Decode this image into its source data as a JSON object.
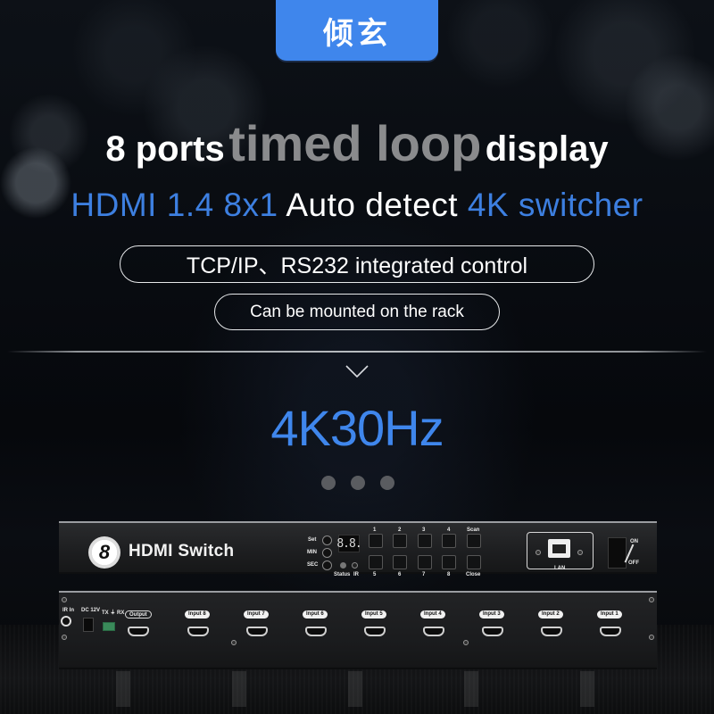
{
  "brand": {
    "name": "倾玄",
    "color": "#3f86ec"
  },
  "headline": {
    "part1": "8 ports",
    "part2": "timed loop",
    "part3": "display"
  },
  "subline": {
    "part1": "HDMI 1.4 8x1",
    "part2": "Auto detect",
    "part3": "4K switcher",
    "accent_color": "#3d7fe0"
  },
  "features": [
    "TCP/IP、RS232 integrated control",
    "Can be mounted on the rack"
  ],
  "resolution": "4K30Hz",
  "carousel": {
    "dots": 3
  },
  "device_front": {
    "logo_glyph": "8",
    "logo_text": "HDMI Switch",
    "knob_labels": [
      "Set",
      "MIN",
      "SEC"
    ],
    "display_value": "8.8.",
    "indicator_labels": [
      "Status",
      "IR"
    ],
    "buttons_top": [
      "1",
      "2",
      "3",
      "4",
      "Scan"
    ],
    "buttons_bottom": [
      "5",
      "6",
      "7",
      "8",
      "Close"
    ],
    "lan_label": "LAN",
    "power_on": "ON",
    "power_off": "OFF"
  },
  "device_back": {
    "ir_label": "IR In",
    "dc_label": "DC 12V",
    "serial_label": "TX ⏚ RX",
    "output_label": "Output",
    "inputs": [
      "Input 8",
      "Input 7",
      "Input 6",
      "Input 5",
      "Input 4",
      "Input 3",
      "Input 2",
      "Input 1"
    ]
  }
}
